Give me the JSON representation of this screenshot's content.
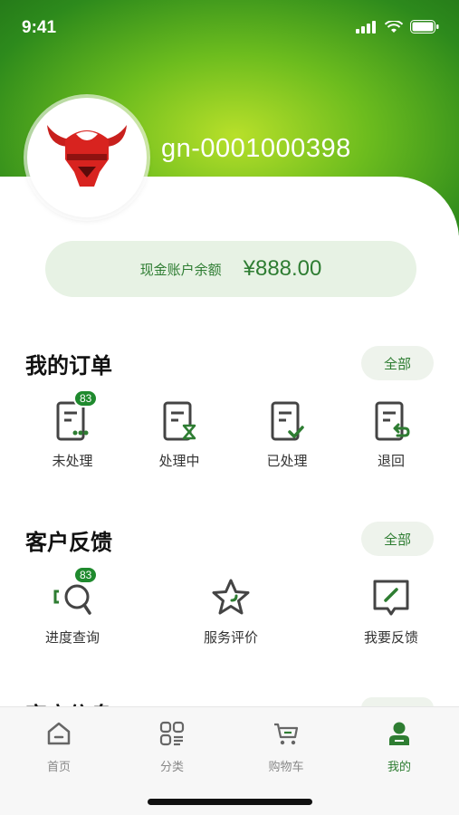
{
  "status": {
    "time": "9:41"
  },
  "profile": {
    "username": "gn-0001000398"
  },
  "balance": {
    "label": "现金账户余额",
    "value": "¥888.00"
  },
  "orders": {
    "title": "我的订单",
    "all_label": "全部",
    "items": [
      {
        "label": "未处理",
        "badge": "83"
      },
      {
        "label": "处理中"
      },
      {
        "label": "已处理"
      },
      {
        "label": "退回"
      }
    ]
  },
  "feedback": {
    "title": "客户反馈",
    "all_label": "全部",
    "items": [
      {
        "label": "进度查询",
        "badge": "83"
      },
      {
        "label": "服务评价"
      },
      {
        "label": "我要反馈"
      }
    ]
  },
  "tabs": [
    {
      "label": "首页"
    },
    {
      "label": "分类"
    },
    {
      "label": "购物车"
    },
    {
      "label": "我的"
    }
  ],
  "colors": {
    "brand": "#2e7d32",
    "badge": "#1f8a2e",
    "icon": "#444444"
  }
}
